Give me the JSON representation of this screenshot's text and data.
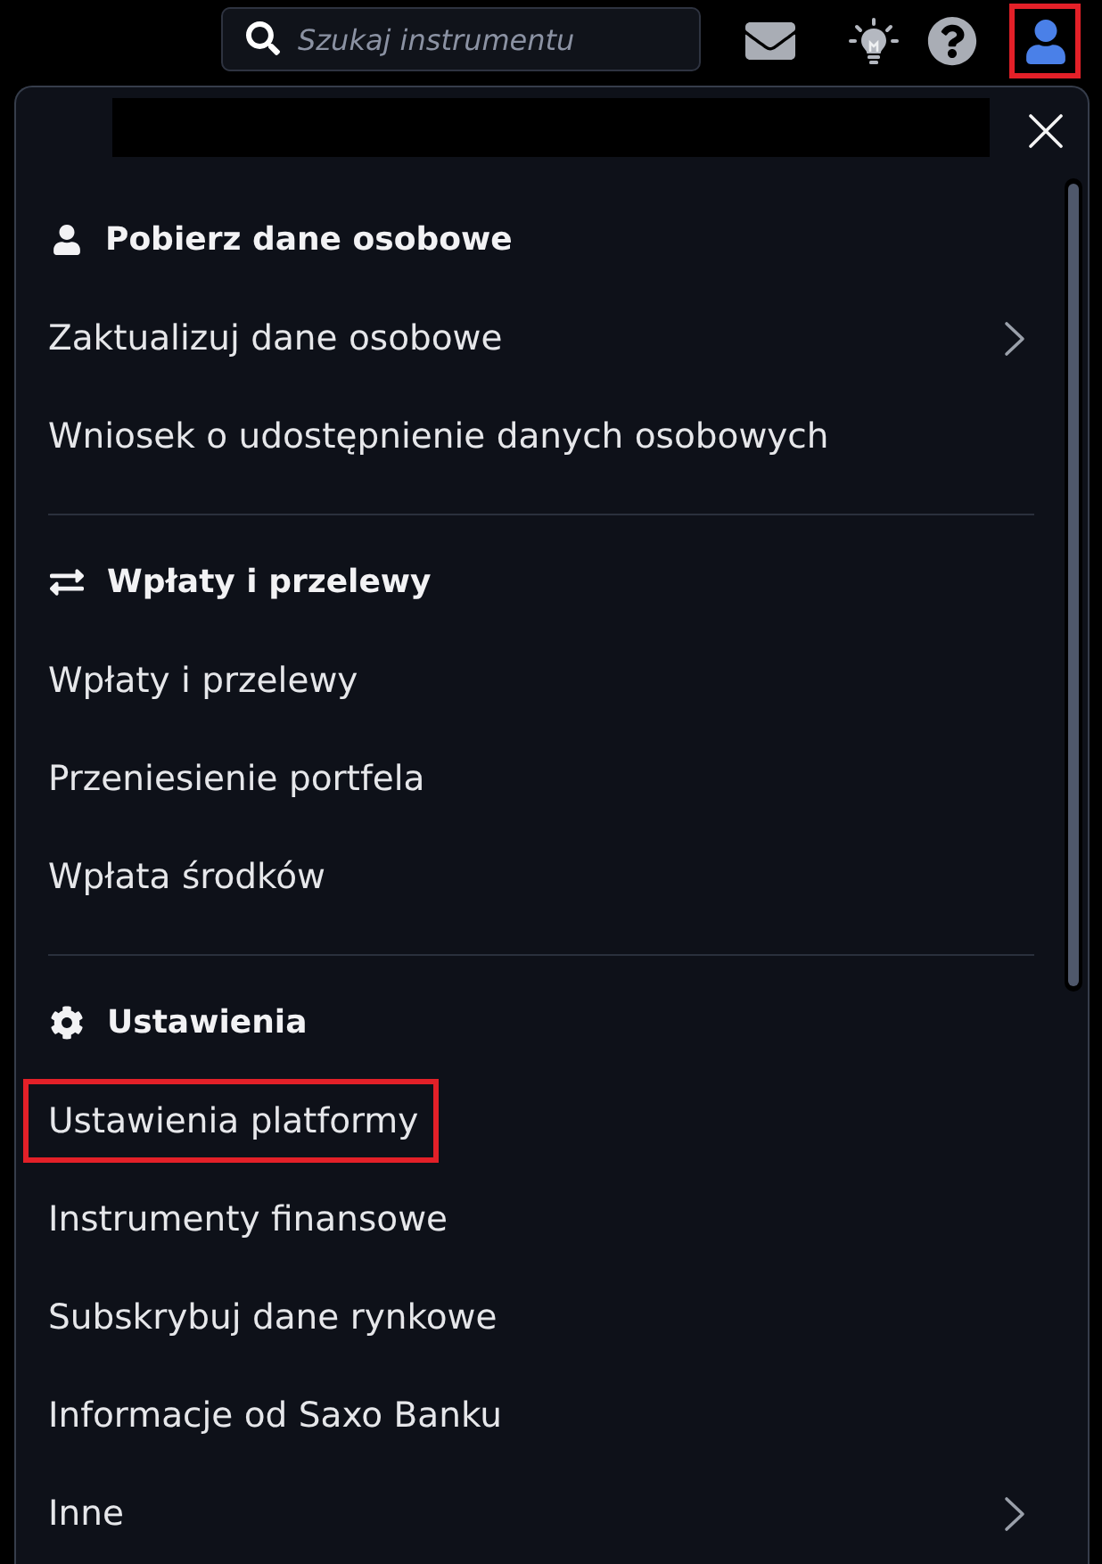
{
  "topbar": {
    "search": {
      "placeholder": "Szukaj instrumentu"
    },
    "user_button": {
      "highlighted": true
    }
  },
  "menu": {
    "sections": [
      {
        "title": "Pobierz dane osobowe",
        "items": [
          {
            "label": "Zaktualizuj dane osobowe",
            "submenu": true,
            "highlighted": false
          },
          {
            "label": "Wniosek o udostępnienie danych osobowych",
            "submenu": false,
            "highlighted": false
          }
        ]
      },
      {
        "title": "Wpłaty i przelewy",
        "items": [
          {
            "label": "Wpłaty i przelewy",
            "submenu": false,
            "highlighted": false
          },
          {
            "label": "Przeniesienie portfela",
            "submenu": false,
            "highlighted": false
          },
          {
            "label": "Wpłata środków",
            "submenu": false,
            "highlighted": false
          }
        ]
      },
      {
        "title": "Ustawienia",
        "items": [
          {
            "label": "Ustawienia platformy",
            "submenu": false,
            "highlighted": true
          },
          {
            "label": "Instrumenty finansowe",
            "submenu": false,
            "highlighted": false
          },
          {
            "label": "Subskrybuj dane rynkowe",
            "submenu": false,
            "highlighted": false
          },
          {
            "label": "Informacje od Saxo Banku",
            "submenu": false,
            "highlighted": false
          },
          {
            "label": "Inne",
            "submenu": true,
            "highlighted": false
          }
        ]
      }
    ]
  }
}
